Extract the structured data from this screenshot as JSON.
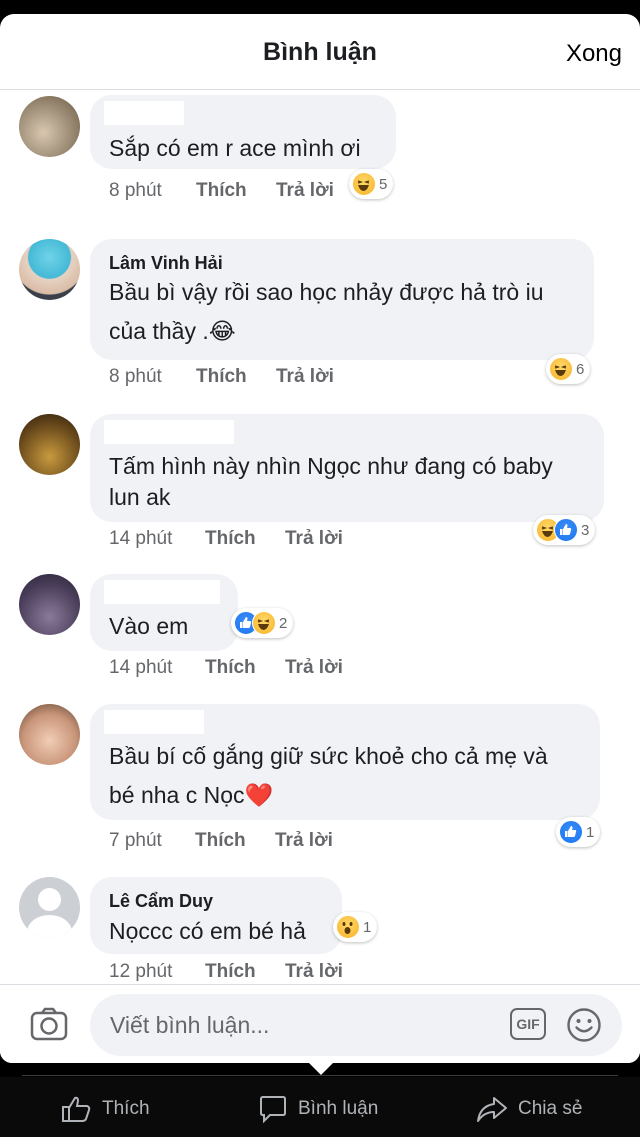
{
  "header": {
    "title": "Bình luận",
    "done_label": "Xong"
  },
  "comments": [
    {
      "author": "",
      "lines": [
        "Sắp có em r ace mình ơi"
      ],
      "time": "8 phút",
      "like": "Thích",
      "reply": "Trả lời",
      "reactions": [
        "haha"
      ],
      "count": "5"
    },
    {
      "author": "Lâm Vinh Hải",
      "lines": [
        "Bầu bì vậy rồi sao học nhảy được hả trò iu",
        "của thầy .😂"
      ],
      "time": "8 phút",
      "like": "Thích",
      "reply": "Trả lời",
      "reactions": [
        "haha"
      ],
      "count": "6"
    },
    {
      "author": "",
      "lines": [
        "Tấm hình này nhìn Ngọc như đang có baby",
        "lun ak"
      ],
      "time": "14 phút",
      "like": "Thích",
      "reply": "Trả lời",
      "reactions": [
        "haha",
        "like"
      ],
      "count": "3"
    },
    {
      "author": "",
      "lines": [
        "Vào em"
      ],
      "time": "14 phút",
      "like": "Thích",
      "reply": "Trả lời",
      "reactions": [
        "like",
        "haha"
      ],
      "count": "2"
    },
    {
      "author": "",
      "lines": [
        "Bầu bí cố gắng giữ sức khoẻ cho cả mẹ và",
        "bé nha c Nọc❤️"
      ],
      "time": "7 phút",
      "like": "Thích",
      "reply": "Trả lời",
      "reactions": [
        "like"
      ],
      "count": "1"
    },
    {
      "author": "Lê Cẩm Duy",
      "lines": [
        "Nọccc có em bé hả"
      ],
      "time": "12 phút",
      "like": "Thích",
      "reply": "Trả lời",
      "reactions": [
        "wow"
      ],
      "count": "1"
    }
  ],
  "composer": {
    "placeholder": "Viết bình luận...",
    "gif_label": "GIF"
  },
  "tabbar": {
    "like": "Thích",
    "comment": "Bình luận",
    "share": "Chia sẻ"
  },
  "colors": {
    "bubble": "#f0f2f5",
    "meta": "#65676b",
    "like_blue": "#1877f2",
    "haha_yellow": "#f7b125",
    "heart_red": "#e0245e"
  }
}
